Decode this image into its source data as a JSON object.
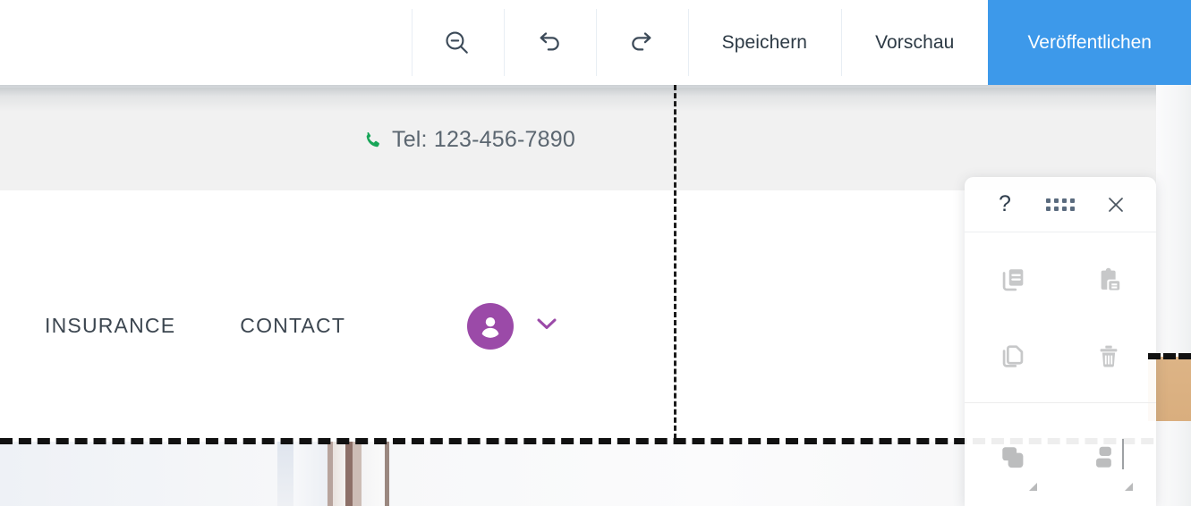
{
  "editor_toolbar": {
    "buttons": [
      {
        "name": "zoom-out",
        "icon": "zoom-out-icon",
        "label": ""
      },
      {
        "name": "undo",
        "icon": "undo-icon",
        "label": ""
      },
      {
        "name": "redo",
        "icon": "redo-icon",
        "label": ""
      }
    ],
    "save_label": "Speichern",
    "preview_label": "Vorschau",
    "publish_label": "Veröffentlichen",
    "primary_color": "#3d99ea",
    "text_color": "#2d3a45"
  },
  "site": {
    "topbar": {
      "phone_icon": "phone-icon",
      "phone_text": "Tel: 123-456-7890",
      "phone_icon_color": "#18a558",
      "background": "#f1f1f1"
    },
    "nav": {
      "items": [
        {
          "label": "INSURANCE"
        },
        {
          "label": "CONTACT"
        }
      ],
      "account": {
        "avatar_icon": "user-avatar-icon",
        "avatar_color": "#9b4aa8",
        "chevron_icon": "chevron-down-icon",
        "chevron_color": "#9b4aa8"
      }
    }
  },
  "selection": {
    "vertical_guide": "dashed",
    "horizontal_guide": "dashed",
    "guide_color": "#111111"
  },
  "float_panel": {
    "header": {
      "help_label": "?",
      "help_icon": "help-icon",
      "drag_icon": "drag-handle-icon",
      "close_label": "×",
      "close_icon": "close-icon"
    },
    "actions": [
      {
        "name": "copy",
        "icon": "copy-icon",
        "disabled": true
      },
      {
        "name": "paste",
        "icon": "paste-icon",
        "disabled": true
      },
      {
        "name": "duplicate",
        "icon": "duplicate-icon",
        "disabled": true
      },
      {
        "name": "delete",
        "icon": "trash-icon",
        "disabled": true
      },
      {
        "name": "group",
        "icon": "group-layers-icon",
        "disabled": true
      },
      {
        "name": "align",
        "icon": "align-icon",
        "disabled": true
      }
    ],
    "icon_color": "#c4c5c6"
  }
}
